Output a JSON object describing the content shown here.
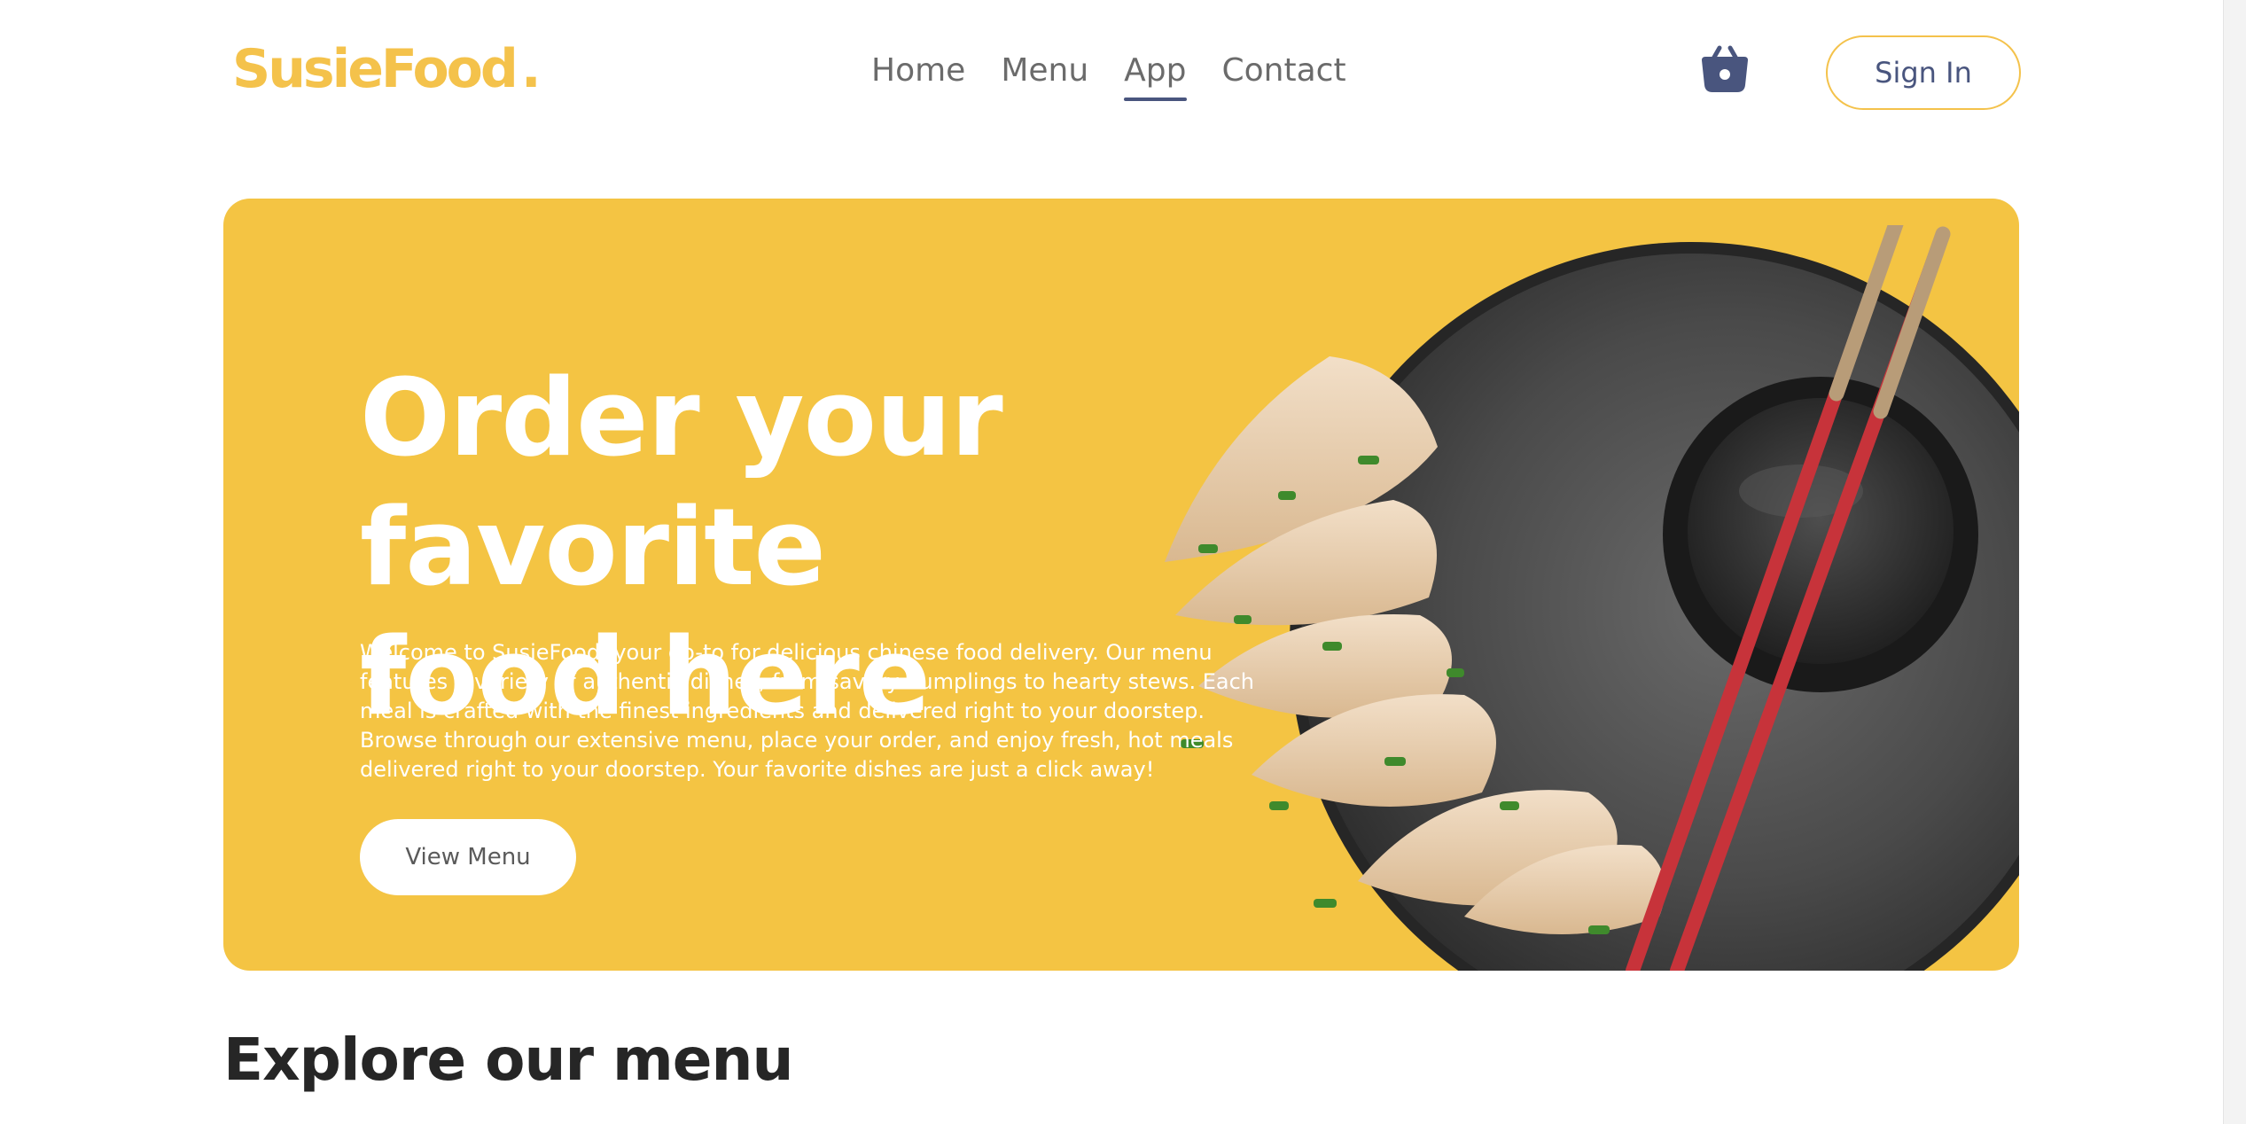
{
  "brand": {
    "name": "SusieFood",
    "dot": ".",
    "color": "#f4c24b"
  },
  "nav": {
    "items": [
      {
        "label": "Home",
        "active": false
      },
      {
        "label": "Menu",
        "active": false
      },
      {
        "label": "App",
        "active": true
      },
      {
        "label": "Contact",
        "active": false
      }
    ],
    "basket_icon": "basket-icon",
    "sign_in_label": "Sign In"
  },
  "hero": {
    "title_line1": "Order your favorite",
    "title_line2": "food here",
    "description": "Welcome to SusieFood, your go-to for delicious chinese food delivery. Our menu features a variety of authentic dishes, from savory dumplings to hearty stews. Each meal is crafted with the finest ingredients and delivered right to your doorstep. Browse through our extensive menu, place your order, and enjoy fresh, hot meals delivered right to your doorstep. Your favorite dishes are just a click away!",
    "cta_label": "View Menu",
    "background_color": "#f4c443",
    "image": "dumplings-plate-image"
  },
  "explore": {
    "heading": "Explore our menu"
  },
  "colors": {
    "accent": "#f4c24b",
    "nav_active": "#49557e",
    "text_dark": "#262626"
  }
}
